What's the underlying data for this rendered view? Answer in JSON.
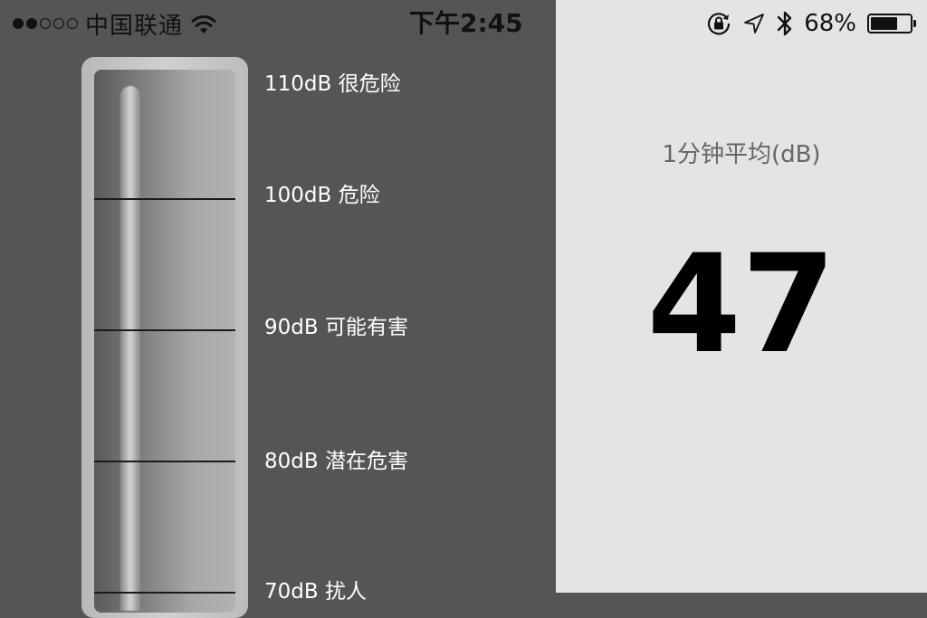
{
  "status_bar": {
    "carrier": "中国联通",
    "time": "下午2:45",
    "battery_text": "68%",
    "battery_level": 0.68,
    "signal_bars_filled": 2,
    "signal_bars_total": 5,
    "icons": [
      "wifi-icon",
      "orientation-lock-icon",
      "location-arrow-icon",
      "bluetooth-icon",
      "battery-icon"
    ]
  },
  "meter": {
    "levels": [
      {
        "label": "110dB 很危险"
      },
      {
        "label": "100dB 危险"
      },
      {
        "label": "90dB 可能有害"
      },
      {
        "label": "80dB 潜在危害"
      },
      {
        "label": "70dB 扰人"
      }
    ]
  },
  "average": {
    "label": "1分钟平均(dB)",
    "value": "47"
  },
  "colors": {
    "left_bg": "#555555",
    "right_bg": "#e4e4e4",
    "text_light": "#ffffff",
    "text_dark": "#000000",
    "label_gray": "#666666"
  }
}
